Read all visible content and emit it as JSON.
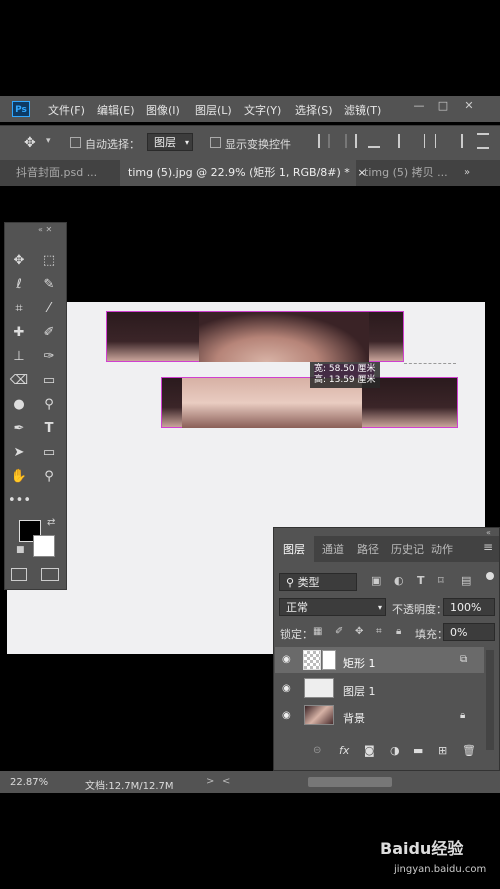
{
  "app": {
    "logo": "Ps"
  },
  "menu": [
    "文件(F)",
    "编辑(E)",
    "图像(I)",
    "图层(L)",
    "文字(Y)",
    "选择(S)",
    "滤镜(T)"
  ],
  "window_controls": [
    "—",
    "□",
    "✕"
  ],
  "options": {
    "auto_select_label": "自动选择：",
    "auto_select_value": "图层",
    "show_transform_label": "显示变换控件"
  },
  "tabs": [
    "抖音封面.psd ...",
    "timg (5).jpg @ 22.9% (矩形 1, RGB/8#) *",
    "timg (5) 拷贝 ..."
  ],
  "tooltip": {
    "line1": "宽: 58.50 厘米",
    "line2": "高: 13.59 厘米"
  },
  "layers_panel": {
    "tabs": [
      "图层",
      "通道",
      "路径",
      "历史记",
      "动作"
    ],
    "filter_label": "类型",
    "blend_mode": "正常",
    "opacity_label": "不透明度：",
    "opacity_value": "100%",
    "lock_label": "锁定：",
    "fill_label": "填充：",
    "fill_value": "0%",
    "layers": [
      {
        "name": "矩形 1"
      },
      {
        "name": "图层 1"
      },
      {
        "name": "背景"
      }
    ]
  },
  "status": {
    "zoom": "22.87%",
    "doc": "文档:12.7M/12.7M"
  },
  "watermark": {
    "brand": "Baidu经验",
    "url": "jingyan.baidu.com"
  },
  "colors": {
    "accent": "#31a8ff",
    "panel": "#535353",
    "selection": "#d040d0"
  }
}
